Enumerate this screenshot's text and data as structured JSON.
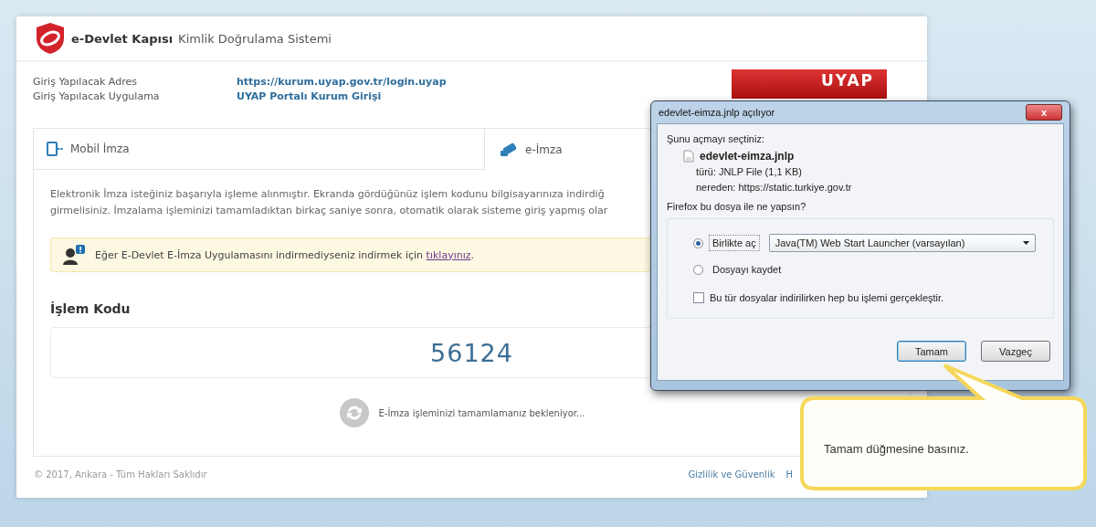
{
  "header": {
    "brand": "e-Devlet Kapısı",
    "title": "Kimlik Doğrulama Sistemi"
  },
  "info": [
    {
      "label": "Giriş Yapılacak Adres",
      "value": "https://kurum.uyap.gov.tr/login.uyap"
    },
    {
      "label": "Giriş Yapılacak Uygulama",
      "value": "UYAP Portalı Kurum Girişi"
    }
  ],
  "banner": "UYAP",
  "tabs": [
    {
      "label": "Mobil İmza",
      "kind": "mobile",
      "selected": false
    },
    {
      "label": "e-İmza",
      "kind": "esign",
      "selected": true
    }
  ],
  "message_lines": [
    "Elektronik İmza isteğiniz başarıyla işleme alınmıştır. Ekranda gördüğünüz işlem kodunu bilgisayarınıza indirdiğ",
    "girmelisiniz. İmzalama işleminizi tamamladıktan birkaç saniye sonra, otomatik olarak sisteme giriş yapmış olar"
  ],
  "notice": {
    "text": "Eğer E-Devlet E-İmza Uygulamasını indirmediyseniz indirmek için",
    "link": "tıklayınız",
    "after": "."
  },
  "code": {
    "label": "İşlem Kodu",
    "value": "56124"
  },
  "waiting": "E-İmza işleminizi tamamlamanız bekleniyor...",
  "footer": {
    "copyright": "© 2017, Ankara - Tüm Hakları Saklıdır",
    "links": [
      "Gizlilik ve Güvenlik",
      "H"
    ]
  },
  "dialog": {
    "title": "edevlet-eimza.jnlp açılıyor",
    "close": "x",
    "intro": "Şunu açmayı seçtiniz:",
    "file": "edevlet-eimza.jnlp",
    "type": "türü: JNLP File (1,1 KB)",
    "source": "nereden: https://static.turkiye.gov.tr",
    "question": "Firefox bu dosya ile ne yapsın?",
    "options": [
      {
        "label": "Birlikte aç",
        "selected": true,
        "app": "Java(TM) Web Start Launcher (varsayılan)"
      },
      {
        "label": "Dosyayı kaydet",
        "selected": false
      }
    ],
    "remember": {
      "label": "Bu tür dosyalar indirilirken hep bu işlemi gerçekleştir.",
      "checked": false
    },
    "buttons": [
      {
        "label": "Tamam",
        "focused": true
      },
      {
        "label": "Vazgeç",
        "focused": false
      }
    ]
  },
  "callout": "Tamam düğmesine basınız."
}
